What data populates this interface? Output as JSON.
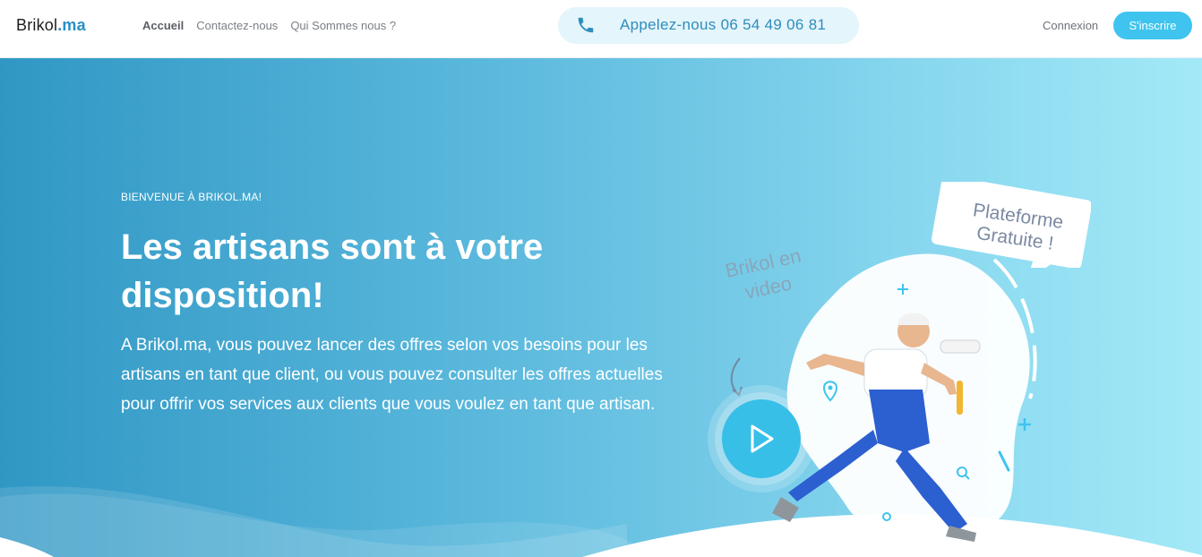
{
  "header": {
    "brand_main": "Brikol",
    "brand_suffix": ".ma",
    "nav": [
      "Accueil",
      "Contactez-nous",
      "Qui Sommes nous ?"
    ],
    "phone": "Appelez-nous 06 54 49 06 81",
    "login": "Connexion",
    "signup": "S'inscrire"
  },
  "hero": {
    "welcome": "BIENVENUE À BRIKOL.MA!",
    "headline_line1": "Les artisans sont à votre",
    "headline_line2": "disposition!",
    "description": "A Brikol.ma, vous pouvez lancer des offres selon vos besoins pour les artisans en tant que client, ou vous pouvez consulter les offres actuelles pour offrir vos services aux clients que vous voulez en tant que artisan."
  },
  "illustration": {
    "bubble_line1": "Plateforme",
    "bubble_line2": "Gratuite !",
    "video_line1": "Brikol en",
    "video_line2": "video"
  },
  "colors": {
    "accent": "#3ec4ee",
    "phone_text": "#2e8dbd",
    "gradient_start": "#3097c4",
    "gradient_end": "#a3e9f7"
  },
  "icons": [
    "phone-icon",
    "play-icon",
    "location-pin-icon",
    "search-icon",
    "plus-icon",
    "arrow-icon"
  ]
}
